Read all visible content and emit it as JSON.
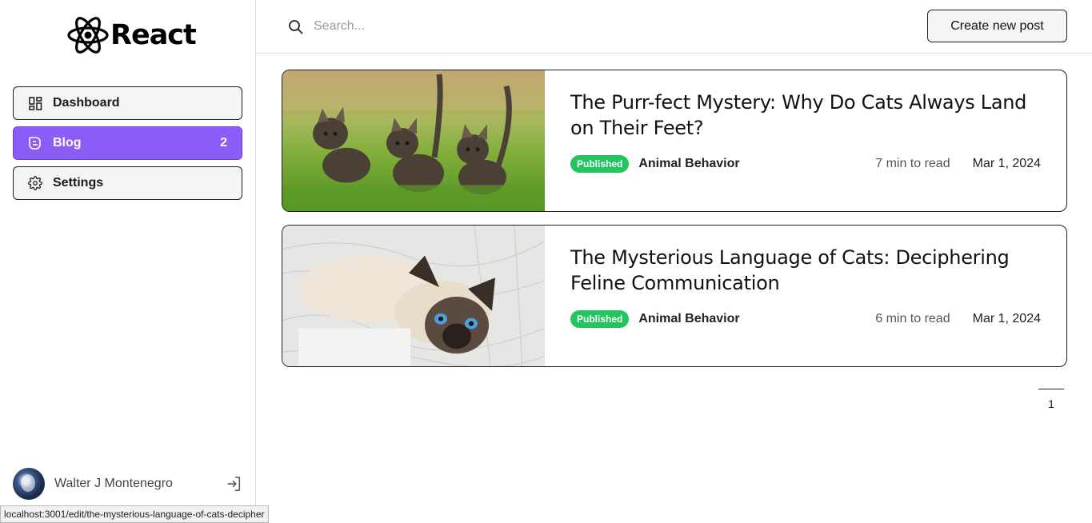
{
  "app": {
    "logo_text": "React"
  },
  "nav": [
    {
      "label": "Dashboard",
      "icon": "dashboard-icon",
      "count": ""
    },
    {
      "label": "Blog",
      "icon": "blog-icon",
      "count": "2",
      "active": true
    },
    {
      "label": "Settings",
      "icon": "gear-icon",
      "count": ""
    }
  ],
  "user": {
    "name": "Walter J Montenegro"
  },
  "search": {
    "placeholder": "Search...",
    "value": ""
  },
  "toolbar": {
    "create_label": "Create new post"
  },
  "posts": [
    {
      "title": "The Purr-fect Mystery: Why Do Cats Always Land on Their Feet?",
      "status": "Published",
      "category": "Animal Behavior",
      "read_time": "7 min to read",
      "date": "Mar 1, 2024"
    },
    {
      "title": "The Mysterious Language of Cats: Deciphering Feline Communication",
      "status": "Published",
      "category": "Animal Behavior",
      "read_time": "6 min to read",
      "date": "Mar 1, 2024"
    }
  ],
  "pagination": {
    "current": "1"
  },
  "status_bar": {
    "url": "localhost:3001/edit/the-mysterious-language-of-cats-decipher"
  },
  "colors": {
    "accent": "#8b5cf6",
    "published": "#22c55e"
  }
}
